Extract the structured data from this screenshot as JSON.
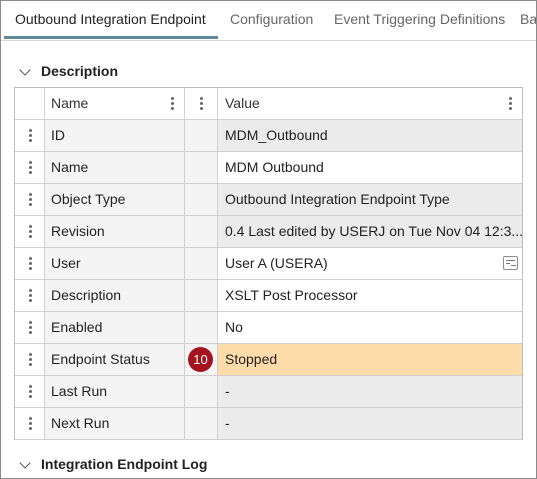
{
  "tabs": [
    {
      "label": "Outbound Integration Endpoint",
      "active": true
    },
    {
      "label": "Configuration",
      "active": false
    },
    {
      "label": "Event Triggering Definitions",
      "active": false
    },
    {
      "label": "Ba",
      "active": false
    }
  ],
  "sections": {
    "description": "Description",
    "log": "Integration Endpoint Log"
  },
  "table": {
    "col_name": "Name",
    "col_value": "Value",
    "rows": [
      {
        "name": "ID",
        "value": "MDM_Outbound"
      },
      {
        "name": "Name",
        "value": "MDM Outbound"
      },
      {
        "name": "Object Type",
        "value": "Outbound Integration Endpoint Type"
      },
      {
        "name": "Revision",
        "value": "0.4 Last edited by USERJ on Tue Nov 04 12:3..."
      },
      {
        "name": "User",
        "value": "User A (USERA)"
      },
      {
        "name": "Description",
        "value": "XSLT Post Processor"
      },
      {
        "name": "Enabled",
        "value": "No"
      },
      {
        "name": "Endpoint Status",
        "value": "Stopped",
        "badge": "10"
      },
      {
        "name": "Last Run",
        "value": "-"
      },
      {
        "name": "Next Run",
        "value": "-"
      }
    ]
  },
  "icons": {
    "section_toggle": "chevron-down-icon",
    "column_menu": "vertical-dots-icon",
    "row_handle": "drag-handle-icon",
    "user_picker": "list-picker-icon"
  },
  "colors": {
    "tab_underline": "#5f8a96",
    "highlight_row": "#fddcaa",
    "badge": "#a3141f",
    "readonly_cell": "#ebebeb"
  }
}
